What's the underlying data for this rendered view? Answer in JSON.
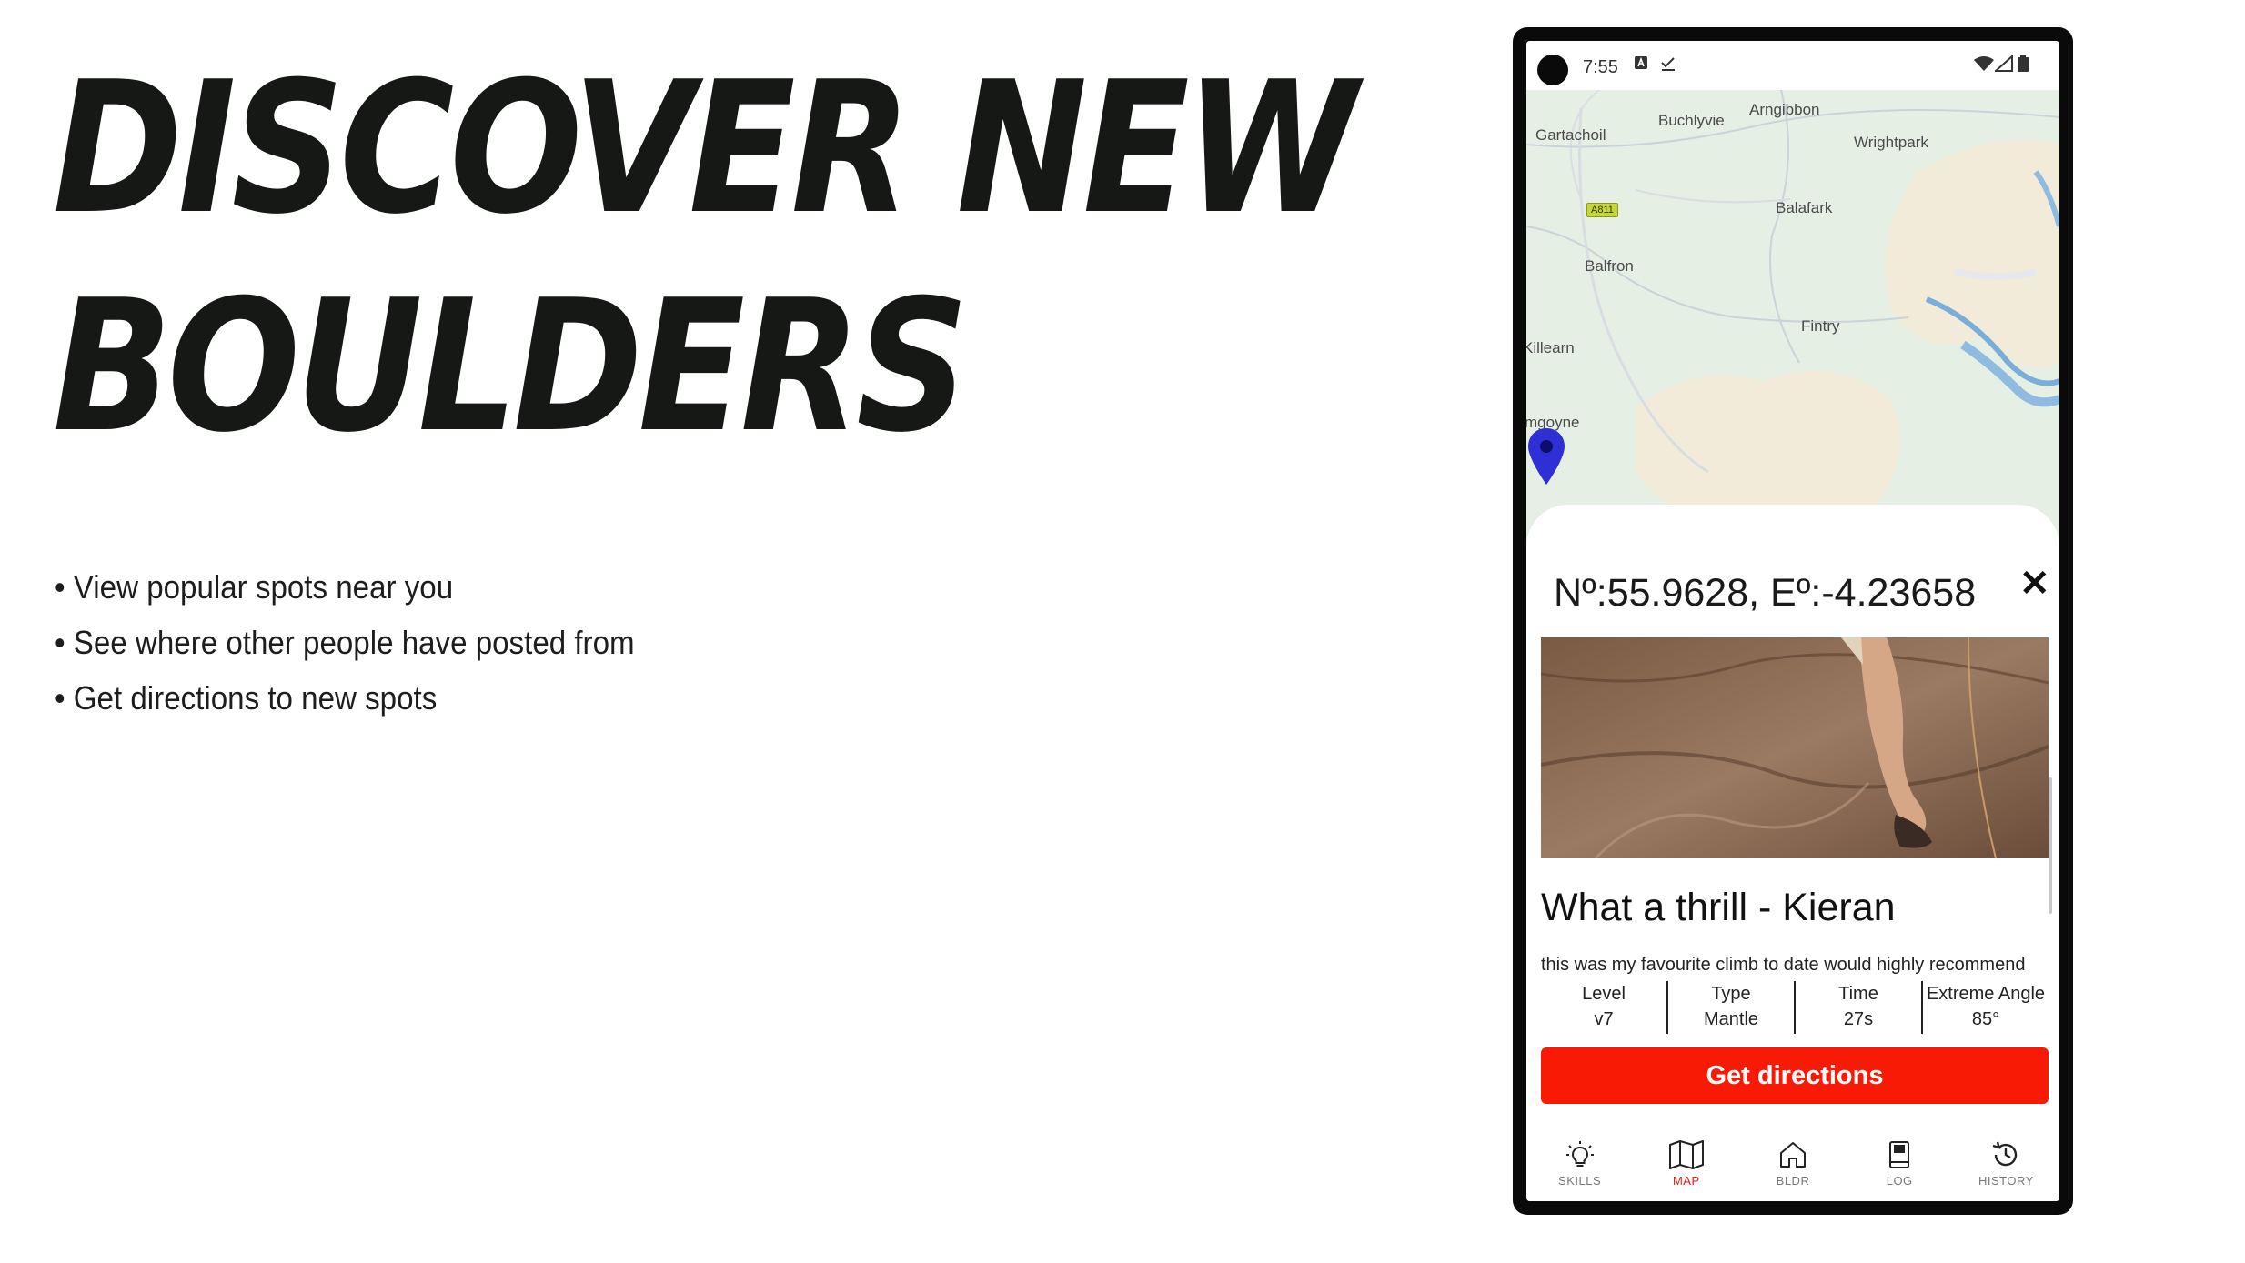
{
  "slide": {
    "headline_line1": "DISCOVER NEW",
    "headline_line2": "BOULDERS",
    "bullets": [
      "View popular spots near you",
      "See where other people have posted from",
      "Get directions to new spots"
    ]
  },
  "phone": {
    "status": {
      "time": "7:55",
      "icons_left": [
        "a-box-icon",
        "check-download-icon"
      ],
      "icons_right": [
        "wifi-icon",
        "signal-icon",
        "battery-icon"
      ]
    },
    "map": {
      "places": [
        "Arngibbon",
        "Buchlyvie",
        "Gartachoil",
        "Wrightpark",
        "Balafark",
        "Balfron",
        "Fintry",
        "Killearn",
        "mgoyne"
      ],
      "road_badge": "A811",
      "pin_color": "#2f2fd6"
    },
    "sheet": {
      "coords": "Nº:55.9628, Eº:-4.23658",
      "close_symbol": "✕",
      "post_title": "What a thrill - Kieran",
      "post_body": "this was my favourite climb to date would highly recommend",
      "stats": [
        {
          "label": "Level",
          "value": "v7"
        },
        {
          "label": "Type",
          "value": "Mantle"
        },
        {
          "label": "Time",
          "value": "27s"
        },
        {
          "label": "Extreme Angle",
          "value": "85°"
        }
      ],
      "button_label": "Get directions",
      "button_color": "#f91a06"
    },
    "nav": {
      "items": [
        {
          "label": "SKILLS",
          "icon": "lightbulb-icon"
        },
        {
          "label": "MAP",
          "icon": "map-icon",
          "active": true
        },
        {
          "label": "BLDR",
          "icon": "home-icon"
        },
        {
          "label": "LOG",
          "icon": "book-icon"
        },
        {
          "label": "HISTORY",
          "icon": "history-icon"
        }
      ],
      "active_color": "#e01b0e"
    }
  }
}
